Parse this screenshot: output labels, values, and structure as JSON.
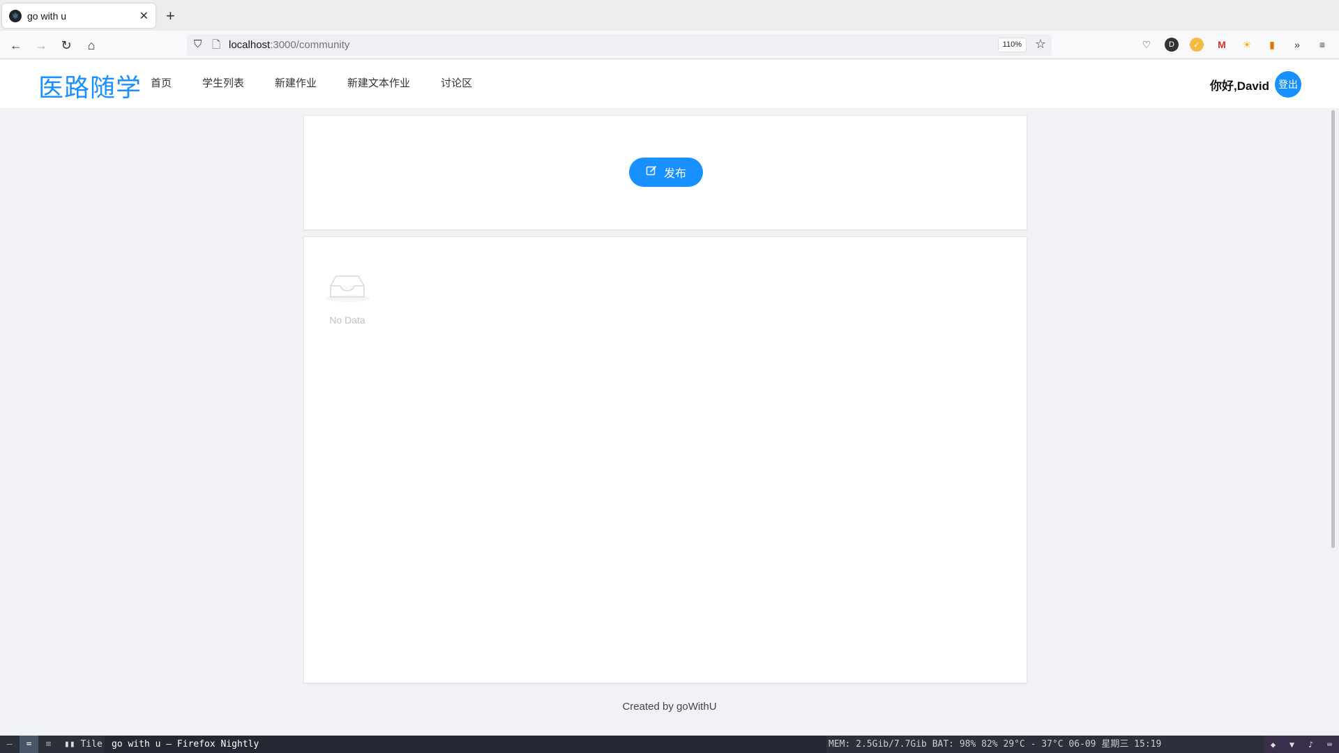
{
  "browser": {
    "tab_title": "go with u",
    "url_host": "localhost",
    "url_path": ":3000/community",
    "zoom": "110%"
  },
  "site": {
    "logo": "医路随学",
    "menu": [
      {
        "label": "首页"
      },
      {
        "label": "学生列表"
      },
      {
        "label": "新建作业"
      },
      {
        "label": "新建文本作业"
      },
      {
        "label": "讨论区"
      }
    ],
    "greeting": "你好,David",
    "logout_label": "登出"
  },
  "main": {
    "publish_label": "发布",
    "empty_text": "No Data"
  },
  "footer": {
    "text": "Created by goWithU"
  },
  "taskbar": {
    "layout_label": "Tile",
    "window_title": "go with u — Firefox Nightly",
    "status": "MEM: 2.5Gib/7.7Gib   BAT: 98%   82%   29°C - 37°C   06-09 星期三 15:19"
  },
  "colors": {
    "accent": "#1890ff",
    "page_bg": "#f0f2f5"
  }
}
